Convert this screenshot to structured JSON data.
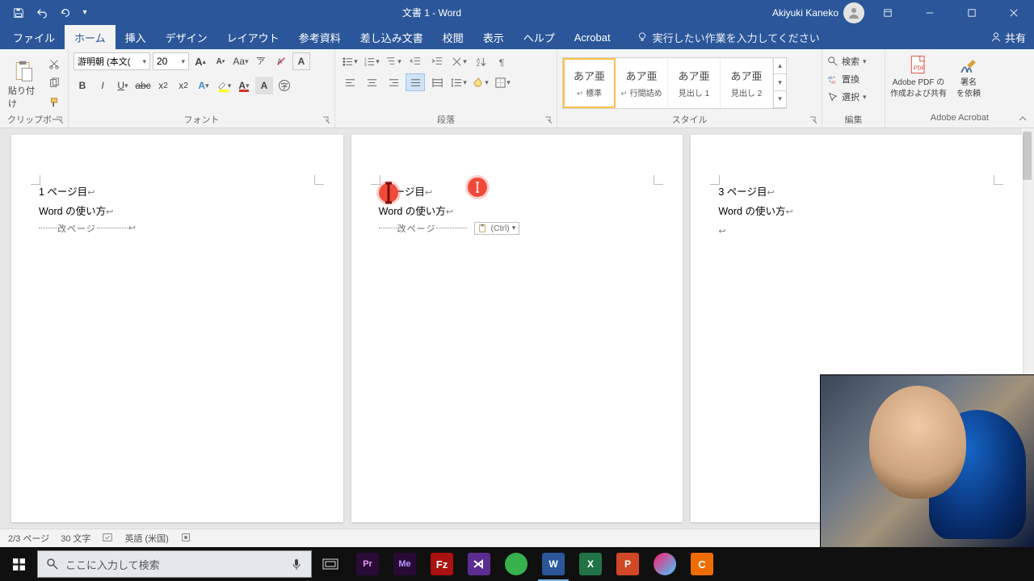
{
  "title": "文書 1  -  Word",
  "user": "Akiyuki Kaneko",
  "tabs": {
    "file": "ファイル",
    "home": "ホーム",
    "insert": "挿入",
    "design": "デザイン",
    "layout": "レイアウト",
    "references": "参考資料",
    "mail": "差し込み文書",
    "review": "校閲",
    "view": "表示",
    "help": "ヘルプ",
    "acrobat": "Acrobat"
  },
  "tellme": "実行したい作業を入力してください",
  "share": "共有",
  "groups": {
    "clipboard": "クリップボード",
    "font": "フォント",
    "paragraph": "段落",
    "styles": "スタイル",
    "editing": "編集",
    "adobe": "Adobe Acrobat"
  },
  "clipboard": {
    "paste": "貼り付け"
  },
  "font": {
    "name": "游明朝 (本文(",
    "size": "20"
  },
  "styles": [
    {
      "preview": "あア亜",
      "name": "標準"
    },
    {
      "preview": "あア亜",
      "name": "行間詰め"
    },
    {
      "preview": "あア亜",
      "name": "見出し 1"
    },
    {
      "preview": "あア亜",
      "name": "見出し 2"
    }
  ],
  "editing": {
    "find": "検索",
    "replace": "置換",
    "select": "選択"
  },
  "adobe": {
    "pdf1": "Adobe PDF の",
    "pdf2": "作成および共有",
    "sig1": "署名",
    "sig2": "を依頼"
  },
  "pages": [
    {
      "l1": "1 ページ目",
      "l2": "Word の使い方",
      "break": "改ページ"
    },
    {
      "l1": "ージ目",
      "l2": "Word の使い方",
      "break": "改ページ",
      "ctrl": "(Ctrl)"
    },
    {
      "l1": "3 ページ目",
      "l2": "Word の使い方"
    }
  ],
  "status": {
    "page": "2/3 ページ",
    "words": "30 文字",
    "lang": "英語 (米国)"
  },
  "search_placeholder": "ここに入力して検索"
}
